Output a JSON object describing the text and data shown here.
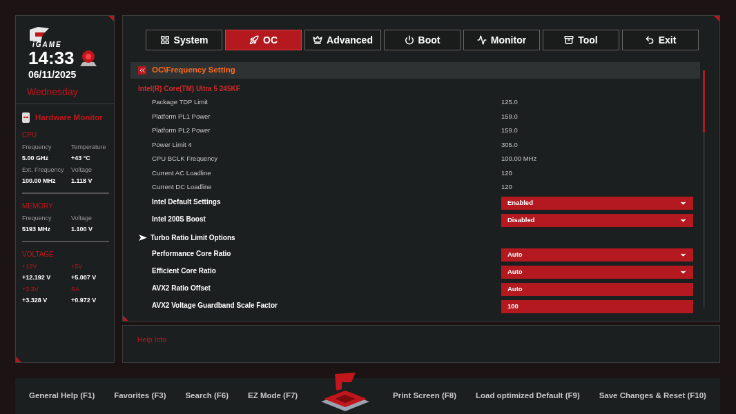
{
  "sidebar": {
    "brand": "iGAME",
    "time": "14:33",
    "date": "06/11/2025",
    "weekday": "Wednesday",
    "monitor_title": "Hardware Monitor",
    "sections": [
      {
        "title": "CPU",
        "items": [
          {
            "label": "Frequency",
            "value": "5.00 GHz"
          },
          {
            "label": "Temperature",
            "value": "+43 °C"
          },
          {
            "label": "Ext. Frequency",
            "value": "100.00 MHz"
          },
          {
            "label": "Voltage",
            "value": "1.118 V"
          }
        ]
      },
      {
        "title": "MEMORY",
        "items": [
          {
            "label": "Frequency",
            "value": "5193 MHz"
          },
          {
            "label": "Voltage",
            "value": "1.100 V"
          }
        ]
      },
      {
        "title": "VOLTAGE",
        "items": [
          {
            "label": "+12V",
            "value": "+12.192 V"
          },
          {
            "label": "+5V",
            "value": "+5.007 V"
          },
          {
            "label": "+3.3V",
            "value": "+3.328 V"
          },
          {
            "label": "SA",
            "value": "+0.972 V"
          }
        ]
      }
    ]
  },
  "tabs": [
    {
      "label": "System",
      "selected": false
    },
    {
      "label": "OC",
      "selected": true
    },
    {
      "label": "Advanced",
      "selected": false
    },
    {
      "label": "Boot",
      "selected": false
    },
    {
      "label": "Monitor",
      "selected": false
    },
    {
      "label": "Tool",
      "selected": false
    },
    {
      "label": "Exit",
      "selected": false
    }
  ],
  "breadcrumb": "OC\\Frequency Setting",
  "cpu_name": "Intel(R) Core(TM) Ultra 5 245KF",
  "settings": [
    {
      "kind": "info",
      "label": "Package TDP Limit",
      "value": "125.0"
    },
    {
      "kind": "info",
      "label": "Platform PL1 Power",
      "value": "159.0"
    },
    {
      "kind": "info",
      "label": "Platform PL2 Power",
      "value": "159.0"
    },
    {
      "kind": "info",
      "label": "Power Limit 4",
      "value": "305.0"
    },
    {
      "kind": "info",
      "label": "CPU BCLK Frequency",
      "value": "100.00 MHz"
    },
    {
      "kind": "info",
      "label": "Current AC Loadline",
      "value": "120"
    },
    {
      "kind": "info",
      "label": "Current DC Loadline",
      "value": "120"
    },
    {
      "kind": "dropdown",
      "label": "Intel Default Settings",
      "value": "Enabled"
    },
    {
      "kind": "dropdown",
      "label": "Intel 200S Boost",
      "value": "Disabled"
    },
    {
      "kind": "submenu",
      "label": "Turbo Ratio Limit Options"
    },
    {
      "kind": "dropdown",
      "label": "Performance Core Ratio",
      "value": "Auto"
    },
    {
      "kind": "dropdown",
      "label": "Efficient Core Ratio",
      "value": "Auto"
    },
    {
      "kind": "field",
      "label": "AVX2 Ratio Offset",
      "value": "Auto"
    },
    {
      "kind": "field",
      "label": "AVX2 Voltage Guardband Scale Factor",
      "value": "100"
    }
  ],
  "help": {
    "title": "Help Info"
  },
  "footer": [
    {
      "label": "General Help (F1)"
    },
    {
      "label": "Favorites (F3)"
    },
    {
      "label": "Search (F6)"
    },
    {
      "label": "EZ Mode (F7)"
    },
    {
      "label": "Print Screen (F8)"
    },
    {
      "label": "Load optimized Default (F9)"
    },
    {
      "label": "Save Changes & Reset (F10)"
    }
  ]
}
